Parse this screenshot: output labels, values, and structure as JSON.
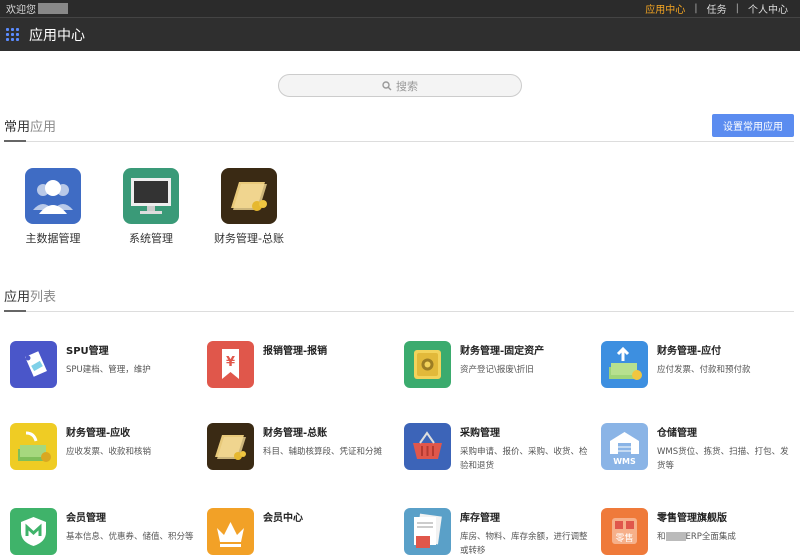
{
  "topbar": {
    "welcome": "欢迎您",
    "links": [
      "应用中心",
      "任务",
      "个人中心"
    ]
  },
  "titlebar": {
    "title": "应用中心"
  },
  "search": {
    "placeholder": "搜索"
  },
  "common": {
    "heading_main": "常用",
    "heading_sub": "应用",
    "button": "设置常用应用",
    "apps": [
      {
        "name": "主数据管理",
        "icon": "users-icon",
        "color": "#3f6cc4"
      },
      {
        "name": "系统管理",
        "icon": "monitor-icon",
        "color": "#3a9a78"
      },
      {
        "name": "财务管理-总账",
        "icon": "ledger-icon",
        "color": "#3a2a14"
      }
    ]
  },
  "list": {
    "heading_main": "应用",
    "heading_sub": "列表",
    "apps": [
      {
        "title": "SPU管理",
        "desc": "SPU建档、管理，维护",
        "icon": "tag-icon",
        "color": "#4a56c9"
      },
      {
        "title": "报销管理-报销",
        "desc": "",
        "icon": "yen-bookmark-icon",
        "color": "#e0574b"
      },
      {
        "title": "财务管理-固定资产",
        "desc": "资产登记\\报废\\折旧",
        "icon": "safe-icon",
        "color": "#3bab6e"
      },
      {
        "title": "财务管理-应付",
        "desc": "应付发票、付款和预付款",
        "icon": "money-out-icon",
        "color": "#3d8fe0"
      },
      {
        "title": "财务管理-应收",
        "desc": "应收发票、收款和核销",
        "icon": "money-in-icon",
        "color": "#efcc24"
      },
      {
        "title": "财务管理-总账",
        "desc": "科目、辅助核算段、凭证和分摊",
        "icon": "ledger-icon",
        "color": "#3a2a14"
      },
      {
        "title": "采购管理",
        "desc": "采购申请、报价、采购、收货、检验和退货",
        "icon": "basket-icon",
        "color": "#3c64b8"
      },
      {
        "title": "仓储管理",
        "desc": "WMS货位、拣货、扫描、打包、发货等",
        "icon": "warehouse-icon",
        "color": "#8ab4e6"
      },
      {
        "title": "会员管理",
        "desc": "基本信息、优惠券、储值、积分等",
        "icon": "member-shield-icon",
        "color": "#3fb36a"
      },
      {
        "title": "会员中心",
        "desc": "",
        "icon": "crown-icon",
        "color": "#f2a127"
      },
      {
        "title": "库存管理",
        "desc": "库房、物料、库存余额，进行调整或转移",
        "icon": "inventory-icon",
        "color": "#5aa0c8"
      },
      {
        "title": "零售管理旗舰版",
        "desc_prefix": "和",
        "desc_suffix": "ERP全面集成",
        "icon": "retail-icon",
        "color": "#ef7a3a"
      }
    ]
  }
}
